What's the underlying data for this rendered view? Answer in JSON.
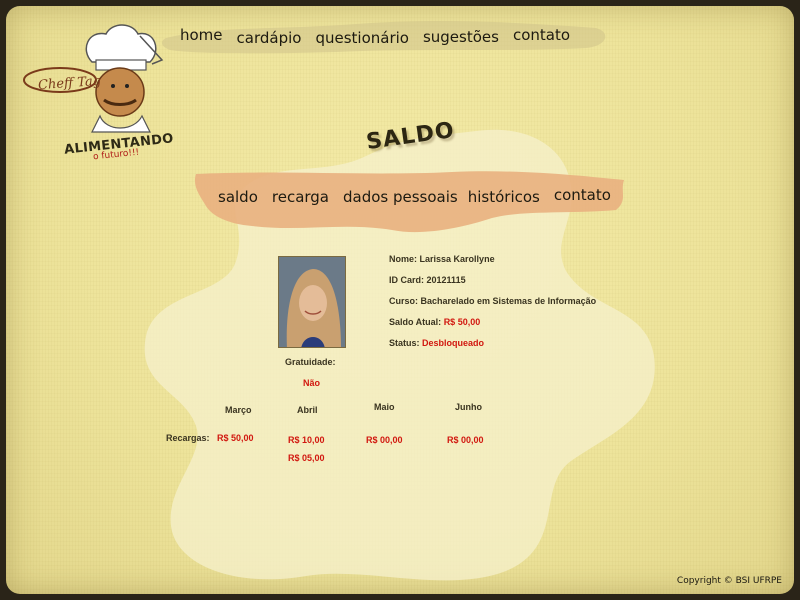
{
  "logo": {
    "script_text": "Cheff Tag",
    "main_text": "ALIMENTANDO",
    "sub_text": "o futuro!!!"
  },
  "top_nav": [
    {
      "label": "home"
    },
    {
      "label": "cardápio"
    },
    {
      "label": "questionário"
    },
    {
      "label": "sugestões"
    },
    {
      "label": "contato"
    }
  ],
  "page_title": "SALDO",
  "sub_nav": [
    {
      "label": "saldo"
    },
    {
      "label": "recarga"
    },
    {
      "label": "dados pessoais"
    },
    {
      "label": "históricos"
    },
    {
      "label": "contato"
    }
  ],
  "profile": {
    "name_label": "Nome:",
    "name": "Larissa Karollyne",
    "id_label": "ID Card:",
    "id": "20121115",
    "course_label": "Curso:",
    "course": "Bacharelado em Sistemas de Informação",
    "balance_label": "Saldo Atual:",
    "balance": "R$ 50,00",
    "status_label": "Status:",
    "status": "Desbloqueado",
    "gratuidade_label": "Gratuidade:",
    "gratuidade": "Não"
  },
  "recharges": {
    "row_label": "Recargas:",
    "months": [
      {
        "month": "Março",
        "values": [
          "R$ 50,00"
        ]
      },
      {
        "month": "Abril",
        "values": [
          "R$ 10,00",
          "R$ 05,00"
        ]
      },
      {
        "month": "Maio",
        "values": [
          "R$ 00,00"
        ]
      },
      {
        "month": "Junho",
        "values": [
          "R$ 00,00"
        ]
      }
    ]
  },
  "footer": {
    "copyright": "Copyright © BSI UFRPE"
  },
  "colors": {
    "accent_red": "#d1170f",
    "brush_orange": "#e9b080",
    "background": "#ede39a"
  }
}
